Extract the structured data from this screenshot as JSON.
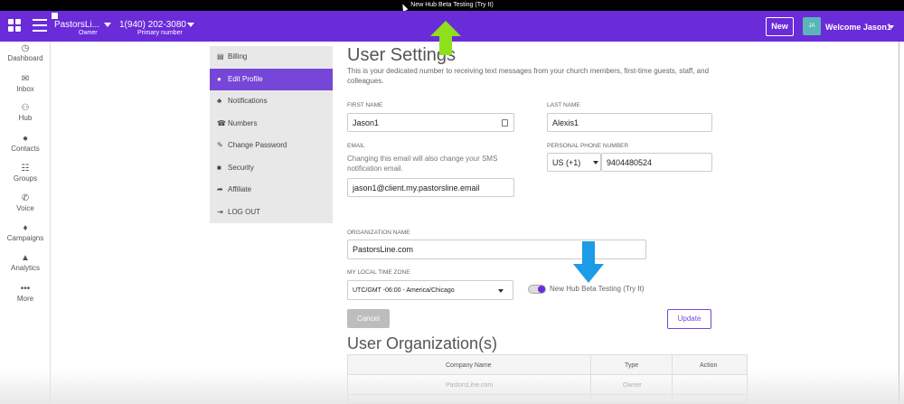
{
  "beta_bar": {
    "text": "New Hub Beta Testing (Try It)"
  },
  "header": {
    "org_name": "PastorsLi...",
    "org_role": "Owner",
    "phone": "1(940) 202-3080",
    "phone_label": "Primary number",
    "new_button": "New",
    "avatar_initials": "JA",
    "welcome": "Welcome Jason1"
  },
  "nav": [
    {
      "label": "Dashboard",
      "icon": "dashboard-icon",
      "glyph": "◷"
    },
    {
      "label": "Inbox",
      "icon": "inbox-icon",
      "glyph": "✉"
    },
    {
      "label": "Hub",
      "icon": "hub-icon",
      "glyph": "⚇"
    },
    {
      "label": "Contacts",
      "icon": "contacts-icon",
      "glyph": "●"
    },
    {
      "label": "Groups",
      "icon": "groups-icon",
      "glyph": "☷"
    },
    {
      "label": "Voice",
      "icon": "voice-icon",
      "glyph": "✆"
    },
    {
      "label": "Campaigns",
      "icon": "campaigns-icon",
      "glyph": "♦"
    },
    {
      "label": "Analytics",
      "icon": "analytics-icon",
      "glyph": "▲"
    },
    {
      "label": "More",
      "icon": "more-icon",
      "glyph": "•••"
    }
  ],
  "menu": [
    {
      "label": "Billing",
      "icon": "billing-icon",
      "glyph": "▤"
    },
    {
      "label": "Edit Profile",
      "icon": "user-icon",
      "glyph": "●"
    },
    {
      "label": "Notifications",
      "icon": "bell-icon",
      "glyph": "♣"
    },
    {
      "label": "Numbers",
      "icon": "phone-icon",
      "glyph": "☎"
    },
    {
      "label": "Change Password",
      "icon": "key-icon",
      "glyph": "✎"
    },
    {
      "label": "Security",
      "icon": "lock-icon",
      "glyph": "■"
    },
    {
      "label": "Affiliate",
      "icon": "share-icon",
      "glyph": "➦"
    },
    {
      "label": "LOG OUT",
      "icon": "logout-icon",
      "glyph": "⇥"
    }
  ],
  "settings": {
    "title": "User Settings",
    "description": "This is your dedicated number to receiving text messages from your church members, first-time guests, staff, and colleagues.",
    "first_name_label": "FIRST NAME",
    "first_name": "Jason1",
    "last_name_label": "LAST NAME",
    "last_name": "Alexis1",
    "email_label": "EMAIL",
    "email_help": "Changing this email will also change your SMS notification email.",
    "email": "jason1@client.my.pastorsline.email",
    "phone_label": "PERSONAL PHONE NUMBER",
    "country_code": "US (+1)",
    "phone": "9404480524",
    "org_name_label": "ORGANIZATION NAME",
    "org_name": "PastorsLine.com",
    "timezone_label": "MY LOCAL TIME ZONE",
    "timezone": "UTC/GMT -06:00 - America/Chicago",
    "toggle_label": "New Hub Beta Testing (Try It)",
    "cancel": "Cancel",
    "update": "Update"
  },
  "organizations": {
    "title": "User Organization(s)",
    "columns": [
      "Company Name",
      "Type",
      "Action"
    ],
    "rows": [
      {
        "company": "PastorsLine.com",
        "type": "Owner"
      }
    ]
  },
  "colors": {
    "brand": "#6a2bd9",
    "menu_active": "#7646d8",
    "green_arrow": "#8ee01c",
    "blue_arrow": "#1c9be6"
  }
}
